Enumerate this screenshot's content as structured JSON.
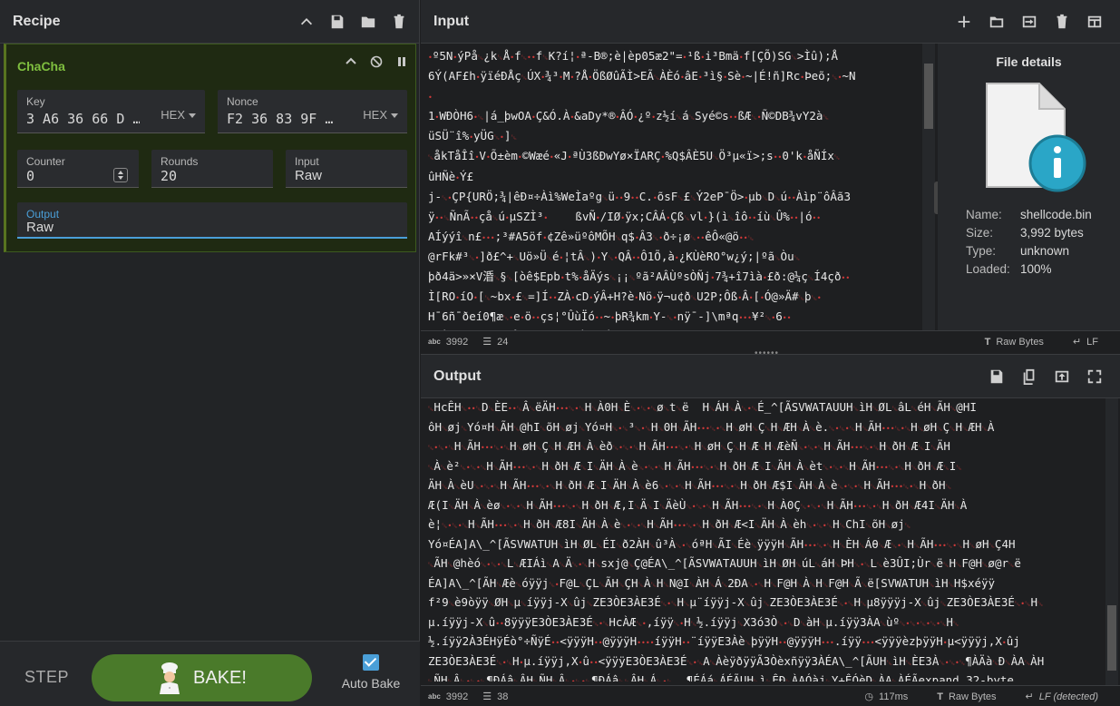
{
  "recipe": {
    "title": "Recipe",
    "operation": {
      "name": "ChaCha",
      "key_label": "Key",
      "key_value": "3 A6 36 66 D …",
      "key_format": "HEX",
      "nonce_label": "Nonce",
      "nonce_value": "F2 36 83 9F …",
      "nonce_format": "HEX",
      "counter_label": "Counter",
      "counter_value": "0",
      "rounds_label": "Rounds",
      "rounds_value": "20",
      "input_label": "Input",
      "input_value": "Raw",
      "output_label": "Output",
      "output_value": "Raw"
    },
    "step_label": "STEP",
    "bake_label": "BAKE!",
    "autobake_label": "Auto Bake",
    "autobake_checked": true
  },
  "input": {
    "title": "Input",
    "lines": [
      "·º5N·ýPå`¿k`Å·f`··f`K?í¦·ª-B®;è|èp05æ2\"=·¹ß·i³Bmä·f[ÇÕ)SG`>Ìû);Å",
      "6Ý(AF£h·ÿïéÐÅç`ÚX·¾³·M·?Å·ÖßØûÃÌ>EÃ`ÀÈó·âE·³ì§·Sè·~|É!ñ]Rc·Þeõ;`·~N",
      "·",
      "1·WÐÒH6·`|á_þwOA·Ç&Ó.À·&aDy*®·ÂÓ·¿º·z½í`á`Syé©s··ßÆ`·Ñ©DB¾vY2à`",
      "üSÜ¨î%·yÜG`·]`",
      "`åkTåÎî·V·Õ±èm·©Wæé·«J·ªÙ3ßÐwYø×ÏARÇ·%Q$ÂÈ5U`Ö³µ«ï>;s··0'k·åÑÍx`",
      "ûHÑè·Ý£",
      "j-`·ÇP{URÖ;¾|êÐ¤÷Àì%WeÌaºg`ü··9··C.·õsF`£`Ý2eP¯Ö>·µb`D`ú··Àìp¨ôÂã3",
      "ÿ··`ÑnÃ··çå`ú·µSZÌ³·    ßvÑ·/IØ·ÿx;CÂÁ·Çß`vl·}(ì`îô··íù`Û%··|ó··",
      "AÍýýî`n£···;³#A5öf·¢Zê»üºôMÕH`q$·Â3`·ð÷¡ø`··êÔ«@ö··`",
      "@rFk#³`·]ð£^+`Uö»Ü`é·¦tÂ`)·Y`·QÂ··Ô1Õ,à·¿KÙèRO°w¿ý;|ºã`Òu`",
      "þð4ä>»×V涽`§`[òê$Epb·t%·åÄýs`¡¡`ºã²AÂÙºsÒÑj·7¾+î7ìà·£ð:@¼ç`Í4çð··",
      "Ì[RO·íO·[`~bx·£`=]Í··ZÀ·cD·ýÂ+H?è·Nö·ÿ¬u¢ð`U2P;Ôß·Â·[·Ó@»Ä#`þ`·",
      "H¯6ñ¯ðeí0¶æ`·e·ö··çs¦°ÛùÏó··~·þR¾km·Y-`·nÿ¯-]\\mªq···¥²`·6··",
      "¬lÀCsjºk^E·4·Å··G·èõà¶ÞêÀdT·É·ú··k·6C`·FÇ$,ªC¤_à·ne?3`·ó",
      "cö×¾ÏÛ7bN&  ýbz·Ÿa`æ«Íîãs`·k·;`·Wd·B·hd&,`·`2··UÏ¯·ý5··Ë\"AB·"
    ],
    "file_details_title": "File details",
    "file_name_label": "Name:",
    "file_name": "shellcode.bin",
    "file_size_label": "Size:",
    "file_size": "3,992 bytes",
    "file_type_label": "Type:",
    "file_type": "unknown",
    "file_loaded_label": "Loaded:",
    "file_loaded": "100%",
    "status_length": "3992",
    "status_lines": "24",
    "encoding": "Raw Bytes",
    "eol": "LF"
  },
  "output": {
    "title": "Output",
    "lines": [
      "`HcÊH`··`D`ÈE··`Â`ëÄH···`·`H`À0H`È`·`·`ø`t`ë  H`ÁH`À`·`É_^[ÃSVWATAUUH`ìH`ØL`âL`éH`ÃH`@HI",
      "ôH`øj`Yó¤H`ÃH`@hI`õH`øj`Yó¤H`·`³`·`H`0H`ÃH···`·`H`øH`Ç`H`ÆH`À`è.`·`·`H`ÃH···`·`H`øH`Ç`H`ÆH`À",
      "`·`·`H`ÃH···`·`H`øH`Ç`H`ÆH`À`èð`·`·`H`ÃH···`·`H`øH`Ç`H`Æ`H`ÆèÑ`·`·`H`ÃH···`·`H`ðH`Æ`I`ÄH",
      "`À`è²`·`·`H`ÃH···`·`H`ðH`Æ`I`ÄH`À`è`·`·`H`ÃH···`·`H`ðH`Æ`I`ÄH`À`èt`·`·`H`ÃH···`·`H`ðH`Æ`I`",
      "ÄH`À`èU`·`·`H`ÃH···`·`H`ðH`Æ`I`ÄH`À`è6`·`·`H`ÃH···`·`H`ðH`Æ$I`ÄH`À`è`·`·`H`ÃH···`·`H`ðH`",
      "Æ(I`ÄH`À`èø`·`·`H`ÃH···`·`H`ðH`Æ,I`Ä`I`ÄèÙ`·`·`H`ÃH···`·`H`À0Ç`·`·`H`ÃH···`·`H`ðH`Æ4I`ÄH`À",
      "è¦`·`·`H`ÃH···`·`H`ðH`Æ8I`ÄH`À`è`·`·`H`ÃH···`·`H`ðH`Æ<I`ÄH`À`èh`·`·`H`ChI`õH`øj`",
      "Yó¤ÉA]A\\_^[ÃSVWATUH`ìH`ØL`ÉI`ð2ÀH`û³À`·`óªH`ÃI`Éè`ÿÿÿH`ÃH···`·`H`ÈH`Áθ`Æ`·`H`ÃH···`·`H`øH`Ç4H",
      "`ÃH`@hèó`·`·`L`ÆIÁì`A`Ä`·`H`sxj@`Ç@ÉA\\_^[ÃSVWATAUUH`ìH`ØH`úL`áH`ÞH`·`L`è3ÛI;Ùr`ë`H`F@H`ø@r`ë",
      "ÉA]A\\_^[ÃH`Æè`óÿÿj`·F@L`ÇL`ÃH`ÇH`À`H`N@I`ÀH`Á`2ÐA`·`H`F@H`À`H`F@H`Ã`ë[SVWATUH`ìH`H$xéÿÿ",
      "f²9`è9òÿÿ`ØH`µ`íÿÿj-X`ûj`ZE3ÒE3ÀE3É`·`H`µ¨íÿÿj-X`ûj`ZE3ÒE3ÀE3É`·`H`µ8ÿÿÿj-X`ûj`ZE3ÒE3ÀE3É`·`H`",
      "µ.íÿÿj-X`û··8ÿÿÿE3ÒE3ÀE3É`·`HcÀÆ`·,íÿÿ`·H`½.íÿÿj`X3ó3Ò`·`D`àH`µ.íÿÿ3ÀA`ùº`·`·`·`·`H`",
      "½.íÿÿ2À3ÉHÿÉò°÷ÑÿÉ··<ÿÿÿH··@ÿÿÿH····íÿÿH··¨íÿÿE3Àè`þÿÿH··@ÿÿÿH···.íÿÿ···<ÿÿÿèzþÿÿH·µ<ÿÿÿj,X·ûj",
      "ZE3ÒE3ÀE3É`·`H·µ.íÿÿj,X·û··<ÿÿÿE3ÒE3ÀE3É`·`A`ÀèÿðÿÿÃ3Òèxñÿÿ3ÀÉA\\_^[ÃUH`ìH`ÈE3À`·`·`¶ÀÄà`Ð`ÀA`ÀH",
      "`ÑH`Â`·`·`¶ÐÁâ`ÂH`ÑH`Â`·`·`¶ÐÁâ``ÂH`Á`·`  ¶ÉÁá`ÁÉÃUH`ì`ÊÐ`ÀAÓàj`Y+ÊÓèD`ÀA`ÀÉÃexpand 32-byte",
      "K`æ`"
    ],
    "status_length": "3992",
    "status_lines": "38",
    "time": "117ms",
    "encoding": "Raw Bytes",
    "eol": "LF (detected)"
  },
  "colors": {
    "accent_green": "#4a7a2a",
    "accent_blue": "#4a9fd8",
    "control_char_red": "#d23a3a"
  }
}
